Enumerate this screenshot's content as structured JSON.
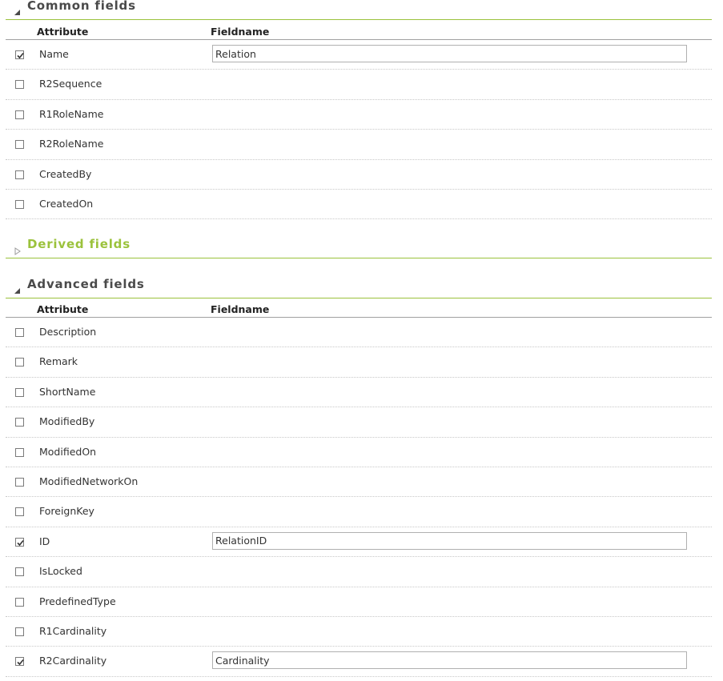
{
  "sections": {
    "common": {
      "title": "Common fields",
      "expanded": true
    },
    "derived": {
      "title": "Derived fields",
      "expanded": false
    },
    "advanced": {
      "title": "Advanced fields",
      "expanded": true
    }
  },
  "columns": {
    "attribute": "Attribute",
    "fieldname": "Fieldname"
  },
  "common_rows": [
    {
      "label": "Name",
      "checked": true,
      "fieldname": "Relation"
    },
    {
      "label": "R2Sequence",
      "checked": false
    },
    {
      "label": "R1RoleName",
      "checked": false
    },
    {
      "label": "R2RoleName",
      "checked": false
    },
    {
      "label": "CreatedBy",
      "checked": false
    },
    {
      "label": "CreatedOn",
      "checked": false
    }
  ],
  "advanced_rows": [
    {
      "label": "Description",
      "checked": false
    },
    {
      "label": "Remark",
      "checked": false
    },
    {
      "label": "ShortName",
      "checked": false
    },
    {
      "label": "ModifiedBy",
      "checked": false
    },
    {
      "label": "ModifiedOn",
      "checked": false
    },
    {
      "label": "ModifiedNetworkOn",
      "checked": false
    },
    {
      "label": "ForeignKey",
      "checked": false
    },
    {
      "label": "ID",
      "checked": true,
      "fieldname": "RelationID"
    },
    {
      "label": "IsLocked",
      "checked": false
    },
    {
      "label": "PredefinedType",
      "checked": false
    },
    {
      "label": "R1Cardinality",
      "checked": false
    },
    {
      "label": "R2Cardinality",
      "checked": true,
      "fieldname": "Cardinality"
    }
  ],
  "colors": {
    "accent": "#9bc23c",
    "text": "#333333"
  }
}
